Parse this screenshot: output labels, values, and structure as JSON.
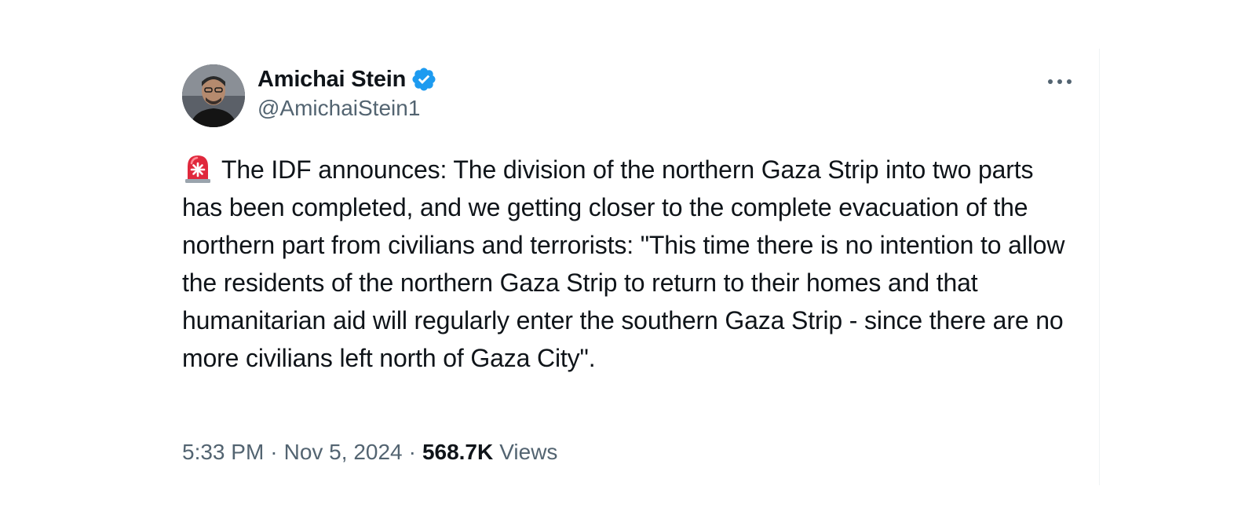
{
  "author": {
    "display_name": "Amichai Stein",
    "handle": "@AmichaiStein1",
    "verified": true,
    "verified_badge_color": "#1d9bf0"
  },
  "tweet": {
    "leading_emoji": "rotating-light-emoji",
    "text": "The IDF announces: The division of the northern Gaza Strip into two parts has been completed, and we getting closer to the complete evacuation of the northern part from civilians and terrorists: \"This time there is no intention to allow the residents of the northern Gaza Strip to return to their homes and that humanitarian aid will regularly enter the southern Gaza Strip - since there are no more civilians left north of Gaza City\"."
  },
  "meta": {
    "time": "5:33 PM",
    "separator": "·",
    "date": "Nov 5, 2024",
    "views_count": "568.7K",
    "views_label": "Views"
  },
  "icons": {
    "more": "more-options-icon",
    "verified": "verified-badge-icon"
  },
  "colors": {
    "text_primary": "#0f1419",
    "text_secondary": "#536471",
    "accent": "#1d9bf0",
    "siren_red": "#e0283c"
  }
}
